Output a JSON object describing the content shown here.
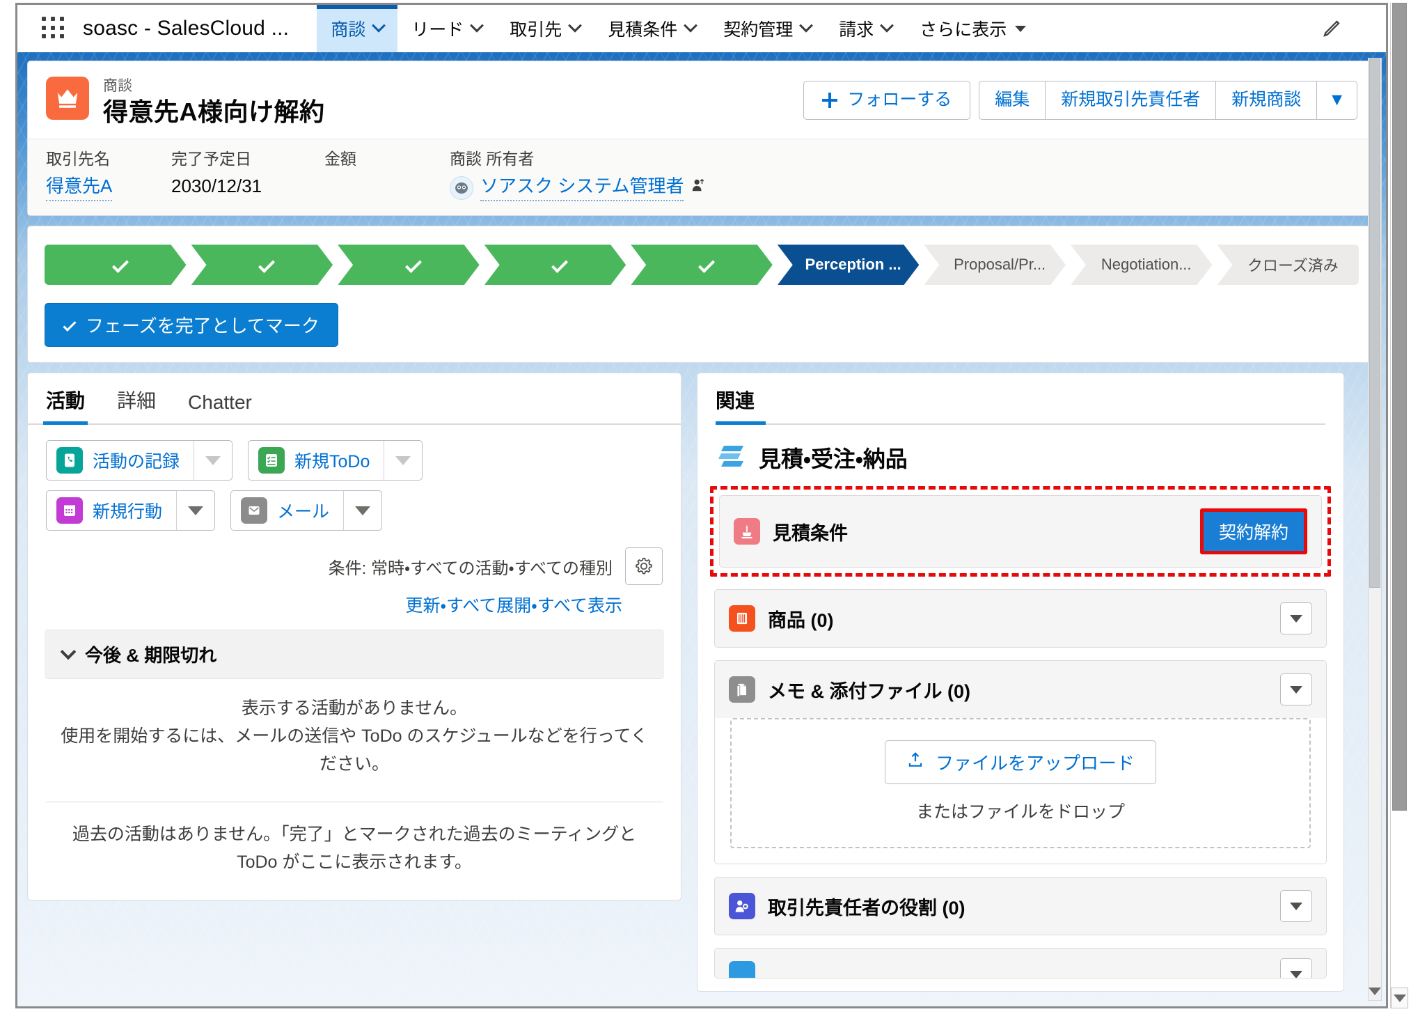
{
  "global_nav": {
    "app_launcher": "app-launcher-icon",
    "app_name": "soasc - SalesCloud ...",
    "items": [
      {
        "label": "商談",
        "active": true
      },
      {
        "label": "リード",
        "active": false
      },
      {
        "label": "取引先",
        "active": false
      },
      {
        "label": "見積条件",
        "active": false
      },
      {
        "label": "契約管理",
        "active": false
      },
      {
        "label": "請求",
        "active": false
      },
      {
        "label": "さらに表示",
        "active": false
      }
    ],
    "edit_icon": "pencil-icon"
  },
  "record_header": {
    "object_label": "商談",
    "title": "得意先A様向け解約",
    "icon": "crown-icon",
    "follow_label": "フォローする",
    "actions": [
      "編集",
      "新規取引先責任者",
      "新規商談"
    ],
    "more_actions": "▼",
    "fields": [
      {
        "label": "取引先名",
        "value": "得意先A",
        "link": true
      },
      {
        "label": "完了予定日",
        "value": "2030/12/31",
        "link": false
      },
      {
        "label": "金額",
        "value": "",
        "link": false
      },
      {
        "label": "商談 所有者",
        "value": "ソアスク システム管理者",
        "link": true
      }
    ]
  },
  "path": {
    "stages": [
      {
        "label": "",
        "state": "done"
      },
      {
        "label": "",
        "state": "done"
      },
      {
        "label": "",
        "state": "done"
      },
      {
        "label": "",
        "state": "done"
      },
      {
        "label": "",
        "state": "done"
      },
      {
        "label": "Perception ...",
        "state": "current"
      },
      {
        "label": "Proposal/Pr...",
        "state": "upcoming"
      },
      {
        "label": "Negotiation...",
        "state": "upcoming"
      },
      {
        "label": "クローズ済み",
        "state": "upcoming"
      }
    ],
    "mark_complete_label": "フェーズを完了としてマーク"
  },
  "activity_panel": {
    "tabs": [
      {
        "label": "活動",
        "active": true
      },
      {
        "label": "詳細",
        "active": false
      },
      {
        "label": "Chatter",
        "active": false
      }
    ],
    "buttons": [
      {
        "label": "活動の記録",
        "icon": "log-a-call-icon",
        "color": "teal"
      },
      {
        "label": "新規ToDo",
        "icon": "new-task-icon",
        "color": "green"
      },
      {
        "label": "新規行動",
        "icon": "new-event-icon",
        "color": "purple"
      },
      {
        "label": "メール",
        "icon": "email-icon",
        "color": "gray"
      }
    ],
    "filter_text": "条件: 常時・すべての活動・すべての種別",
    "settings_icon": "gear-icon",
    "links_text": "更新・すべて展開・すべて表示",
    "section_title": "今後 & 期限切れ",
    "empty_line1": "表示する活動がありません。",
    "empty_line2": "使用を開始するには、メールの送信や ToDo のスケジュールなどを行ってください。",
    "past_text": "過去の活動はありません。「完了」とマークされた過去のミーティングと ToDo がここに表示されます。"
  },
  "related_panel": {
    "tab_label": "関連",
    "section_title": "見積・受注・納品",
    "section_icon": "stacked-bars-icon",
    "quote_condition": {
      "label": "見積条件",
      "icon": "quote-icon",
      "button_label": "契約解約",
      "highlight_color": "#e60b0b",
      "button_color": "#1a7fd4"
    },
    "cards": [
      {
        "label": "商品 (0)",
        "icon": "product-icon",
        "color": "orange",
        "has_body": false
      },
      {
        "label": "メモ & 添付ファイル (0)",
        "icon": "note-attachment-icon",
        "color": "gray",
        "has_body": true,
        "upload_label": "ファイルをアップロード",
        "drop_label": "またはファイルをドロップ",
        "upload_icon": "upload-icon"
      },
      {
        "label": "取引先責任者の役割 (0)",
        "icon": "contact-role-icon",
        "color": "blue",
        "has_body": false
      },
      {
        "label": "",
        "icon": "partial-card-icon",
        "color": "lightblue",
        "has_body": false
      }
    ]
  }
}
